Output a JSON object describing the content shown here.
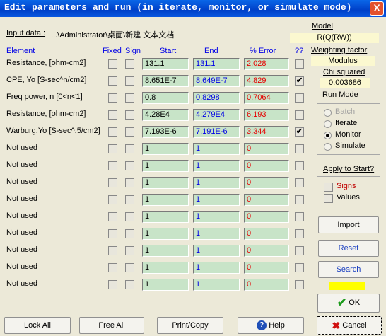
{
  "window": {
    "title": "Edit parameters and run (in iterate, monitor, or simulate mode)",
    "close": "X"
  },
  "input": {
    "label": "Input data :",
    "path": "...\\Administrator\\桌面\\新建 文本文档"
  },
  "headers": {
    "element": "Element",
    "fixed": "Fixed",
    "sign": "Sign",
    "start": "Start",
    "end": "End",
    "error": "% Error",
    "qq": "??"
  },
  "rows": [
    {
      "element": "Resistance,    [ohm-cm2]",
      "fixed": false,
      "sign": false,
      "start": "131.1",
      "end": "131.1",
      "error": "2.028",
      "qq": false
    },
    {
      "element": "CPE,  Yo  [S-sec^n/cm2]",
      "fixed": false,
      "sign": false,
      "start": "8.651E-7",
      "end": "8.649E-7",
      "error": "4.829",
      "qq": true
    },
    {
      "element": "Freq power, n   [0<n<1]",
      "fixed": false,
      "sign": false,
      "start": "0.8",
      "end": "0.8298",
      "error": "0.7064",
      "qq": false
    },
    {
      "element": "Resistance,    [ohm-cm2]",
      "fixed": false,
      "sign": false,
      "start": "4.28E4",
      "end": "4.279E4",
      "error": "6.193",
      "qq": false
    },
    {
      "element": "Warburg,Yo [S-sec^.5/cm2]",
      "fixed": false,
      "sign": false,
      "start": "7.193E-6",
      "end": "7.191E-6",
      "error": "3.344",
      "qq": true
    },
    {
      "element": "Not used",
      "fixed": false,
      "sign": false,
      "start": "1",
      "end": "1",
      "error": "0",
      "qq": false
    },
    {
      "element": "Not used",
      "fixed": false,
      "sign": false,
      "start": "1",
      "end": "1",
      "error": "0",
      "qq": false
    },
    {
      "element": "Not used",
      "fixed": false,
      "sign": false,
      "start": "1",
      "end": "1",
      "error": "0",
      "qq": false
    },
    {
      "element": "Not used",
      "fixed": false,
      "sign": false,
      "start": "1",
      "end": "1",
      "error": "0",
      "qq": false
    },
    {
      "element": "Not used",
      "fixed": false,
      "sign": false,
      "start": "1",
      "end": "1",
      "error": "0",
      "qq": false
    },
    {
      "element": "Not used",
      "fixed": false,
      "sign": false,
      "start": "1",
      "end": "1",
      "error": "0",
      "qq": false
    },
    {
      "element": "Not used",
      "fixed": false,
      "sign": false,
      "start": "1",
      "end": "1",
      "error": "0",
      "qq": false
    },
    {
      "element": "Not used",
      "fixed": false,
      "sign": false,
      "start": "1",
      "end": "1",
      "error": "0",
      "qq": false
    },
    {
      "element": "Not used",
      "fixed": false,
      "sign": false,
      "start": "1",
      "end": "1",
      "error": "0",
      "qq": false
    }
  ],
  "side": {
    "model_label": "Model",
    "model_value": "R(Q(RW))",
    "weighting_label": "Weighting  factor",
    "weighting_value": "Modulus",
    "chi_label": "Chi squared",
    "chi_value": "0.003686",
    "run_mode_label": "Run Mode",
    "run_modes": [
      {
        "label": "Batch",
        "selected": false,
        "enabled": false
      },
      {
        "label": "Iterate",
        "selected": false,
        "enabled": true
      },
      {
        "label": "Monitor",
        "selected": true,
        "enabled": true
      },
      {
        "label": "Simulate",
        "selected": false,
        "enabled": true
      }
    ],
    "apply_label": "Apply to Start?",
    "apply_signs": "Signs",
    "apply_values": "Values",
    "import": "Import",
    "reset": "Reset",
    "search": "Search",
    "indicator_color": "#ffff00",
    "ok": "OK"
  },
  "bottom": {
    "lock_all": "Lock All",
    "free_all": "Free All",
    "print_copy": "Print/Copy",
    "help": "Help",
    "cancel": "Cancel"
  },
  "colors": {
    "field_bg": "#c8e4c8",
    "start_text": "#000000",
    "end_text": "#0000e6",
    "error_text": "#e60000",
    "title_bar": "#0a58e0"
  }
}
